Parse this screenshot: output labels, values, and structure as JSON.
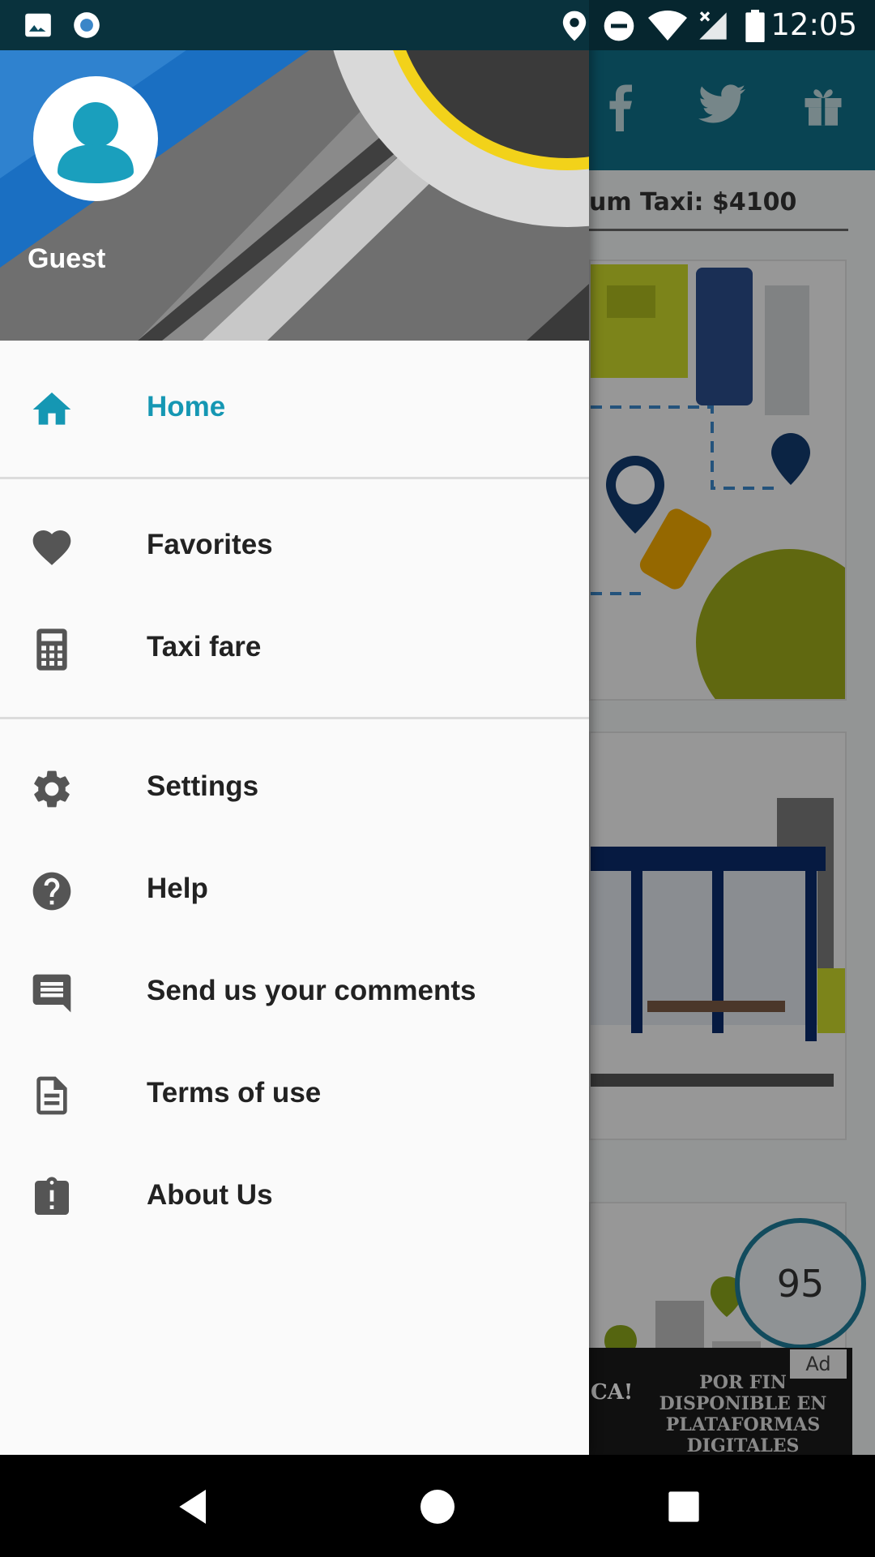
{
  "status_bar": {
    "time": "12:05",
    "icons": [
      "image-icon",
      "record-icon",
      "location-pin-icon",
      "do-not-disturb-icon",
      "wifi-icon",
      "no-signal-icon",
      "battery-icon"
    ]
  },
  "drawer": {
    "user_name": "Guest",
    "menu": [
      {
        "label": "Home",
        "icon": "home-icon",
        "active": true
      },
      {
        "label": "Favorites",
        "icon": "heart-icon"
      },
      {
        "label": "Taxi fare",
        "icon": "calculator-icon"
      },
      {
        "label": "Settings",
        "icon": "gear-icon"
      },
      {
        "label": "Help",
        "icon": "help-icon"
      },
      {
        "label": "Send us your comments",
        "icon": "comment-icon"
      },
      {
        "label": "Terms of use",
        "icon": "document-icon"
      },
      {
        "label": "About Us",
        "icon": "about-icon"
      }
    ]
  },
  "background_app": {
    "fare_text": "um Taxi: $4100",
    "speed_value": "95",
    "ad_tag": "Ad",
    "ad_text": "POR FIN DISPONIBLE EN PLATAFORMAS DIGITALES",
    "ad_logo": "CA!"
  },
  "colors": {
    "accent": "#1597b3",
    "toolbar": "#0f6f86",
    "drawer_bg": "#fafafa",
    "text": "#222222",
    "icon": "#555555"
  }
}
